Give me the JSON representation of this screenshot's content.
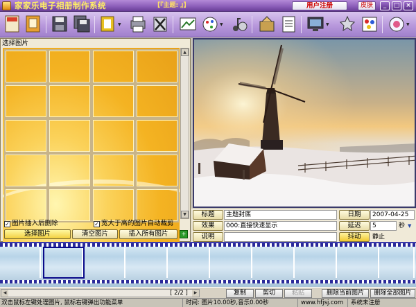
{
  "window": {
    "title": "家家乐电子相册制作系统",
    "subject": "【『主题: 』】",
    "register_label": "用户注册",
    "skin_label": "皮肤",
    "minimize": "_",
    "maximize": "□",
    "close": "×"
  },
  "left_panel": {
    "header": "选择图片",
    "options": {
      "delete_after_insert": "图片插入后删除",
      "auto_crop": "宽大于高的图片自动裁剪"
    },
    "buttons": {
      "select": "选择图片",
      "clear": "清空图片",
      "insert_all": "插入所有图片"
    }
  },
  "info": {
    "title_label": "标题",
    "title_value": "主题封底",
    "effect_label": "效果",
    "effect_value": "000:直接快速显示",
    "desc_label": "说明",
    "desc_value": "",
    "date_label": "日期",
    "date_value": "2007-04-25",
    "delay_label": "延迟",
    "delay_value": "5",
    "delay_unit": "秒",
    "shake_label": "抖动",
    "shake_value": "静止"
  },
  "bottom": {
    "page_indicator": "[ 2/2 ]",
    "copy": "复制",
    "cut": "剪切",
    "paste": "粘贴",
    "delete_current": "删除当前图片",
    "delete_all": "删除全部图片"
  },
  "status": {
    "hint": "双击鼠标左键处理图片, 鼠标右键弹出功能菜单",
    "time": "时间: 图片10.00秒,音乐0.00秒",
    "website": "www.hfjsj.com",
    "registration": "系统未注册"
  }
}
